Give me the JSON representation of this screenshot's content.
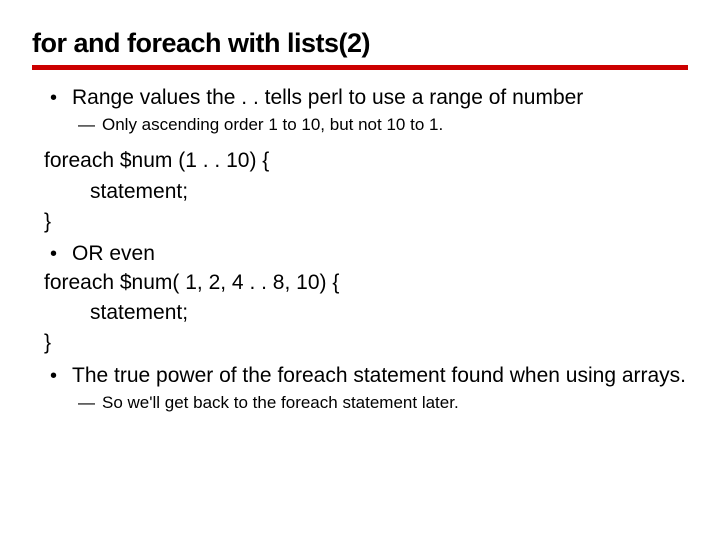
{
  "title": "for and foreach with lists(2)",
  "bullets": {
    "b1": "Range values  the . . tells perl to use a range of number",
    "sub1": "Only ascending order 1 to 10, but not 10 to 1.",
    "code1_l1": "foreach $num (1 . . 10) {",
    "code1_l2": "statement;",
    "code1_l3": "}",
    "b2": "OR even",
    "code2_l1": "foreach $num( 1, 2, 4 . . 8, 10) {",
    "code2_l2": "statement;",
    "code2_l3": "}",
    "b3": "The true power of the foreach statement found when using arrays.",
    "sub3": "So we'll get back to the foreach statement later."
  }
}
